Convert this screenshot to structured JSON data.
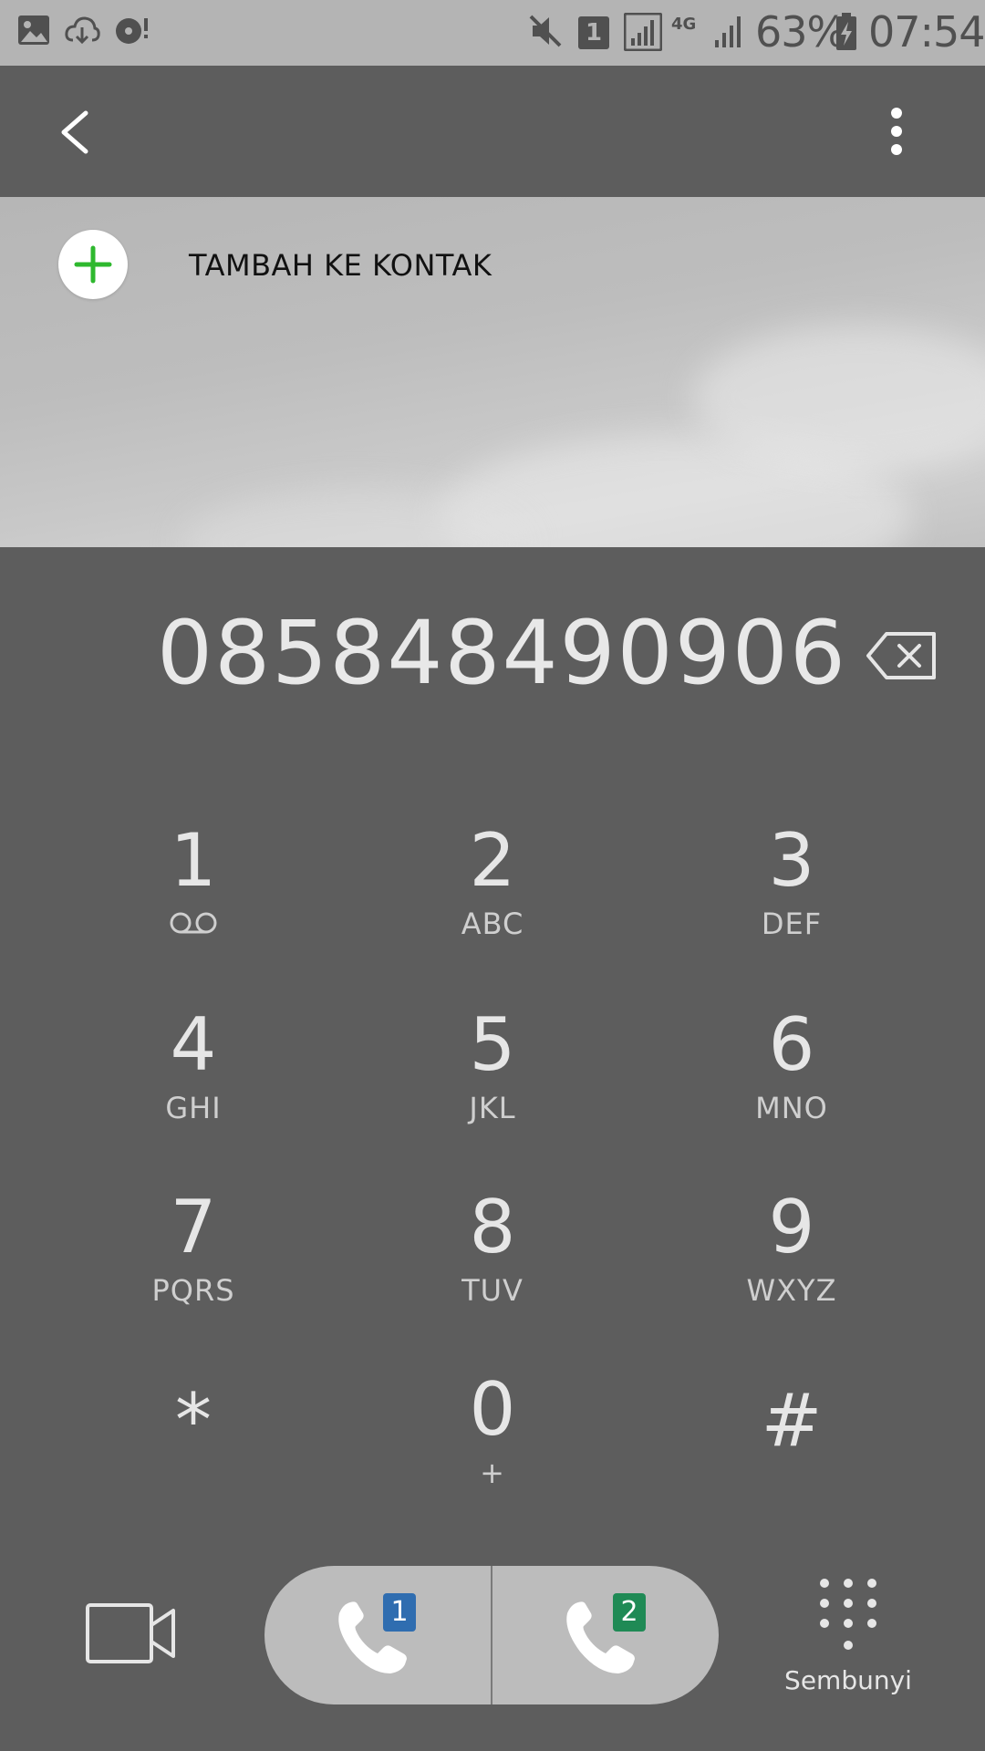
{
  "status_bar": {
    "battery_percent": "63%",
    "time": "07:54",
    "sim_slot": "1",
    "network": "4G",
    "icons": [
      "gallery-icon",
      "cloud-sync-icon",
      "media-icon",
      "mute-icon",
      "sim-icon",
      "signal-icon",
      "data-4g-icon",
      "signal-icon",
      "battery-charging-icon"
    ]
  },
  "toolbar": {
    "back_icon": "chevron-left-icon",
    "more_icon": "more-vertical-icon"
  },
  "contact": {
    "add_label": "TAMBAH KE KONTAK",
    "add_icon": "plus-icon",
    "accent": "#2eb82e"
  },
  "dialer": {
    "number": "085848490906",
    "backspace_icon": "backspace-icon"
  },
  "keypad": {
    "keys": [
      {
        "digit": "1",
        "letters": ""
      },
      {
        "digit": "2",
        "letters": "ABC"
      },
      {
        "digit": "3",
        "letters": "DEF"
      },
      {
        "digit": "4",
        "letters": "GHI"
      },
      {
        "digit": "5",
        "letters": "JKL"
      },
      {
        "digit": "6",
        "letters": "MNO"
      },
      {
        "digit": "7",
        "letters": "PQRS"
      },
      {
        "digit": "8",
        "letters": "TUV"
      },
      {
        "digit": "9",
        "letters": "WXYZ"
      },
      {
        "digit": "*",
        "letters": ""
      },
      {
        "digit": "0",
        "letters": "+"
      },
      {
        "digit": "#",
        "letters": ""
      }
    ]
  },
  "bottom_bar": {
    "video_icon": "video-camera-icon",
    "call_sim1_label": "1",
    "call_sim2_label": "2",
    "sim1_color": "#2f6db0",
    "sim2_color": "#1f8a55",
    "hide_label": "Sembunyi"
  }
}
